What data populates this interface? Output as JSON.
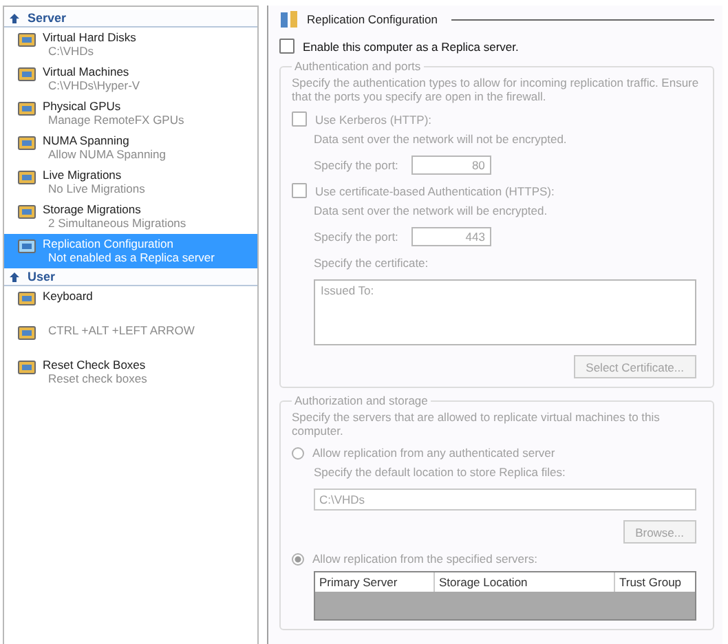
{
  "sidebar": {
    "groups": [
      {
        "title": "Server",
        "items": [
          {
            "title": "Virtual Hard Disks",
            "subtitle": "C:\\VHDs",
            "selected": false
          },
          {
            "title": "Virtual Machines",
            "subtitle": "C:\\VHDs\\Hyper-V",
            "selected": false
          },
          {
            "title": "Physical GPUs",
            "subtitle": "Manage RemoteFX GPUs",
            "selected": false
          },
          {
            "title": "NUMA Spanning",
            "subtitle": "Allow NUMA Spanning",
            "selected": false
          },
          {
            "title": "Live Migrations",
            "subtitle": "No Live Migrations",
            "selected": false
          },
          {
            "title": "Storage Migrations",
            "subtitle": "2 Simultaneous Migrations",
            "selected": false
          },
          {
            "title": "Replication Configuration",
            "subtitle": "Not enabled as a Replica server",
            "selected": true
          }
        ]
      },
      {
        "title": "User",
        "items": [
          {
            "title": "Keyboard",
            "selected": false
          },
          {
            "subtitle": "CTRL +ALT +LEFT ARROW",
            "selected": false
          },
          {
            "title": "Reset Check Boxes",
            "subtitle": "Reset check boxes",
            "selected": false
          }
        ]
      }
    ]
  },
  "panel": {
    "title": "Replication Configuration",
    "enable": {
      "label": "Enable this computer as a Replica server.",
      "checked": false
    },
    "auth": {
      "title": "Authentication and ports",
      "disabled": true,
      "description": "Specify the authentication types to allow for incoming replication traffic. Ensure that the ports you specify are open in the firewall.",
      "kerberos": {
        "label": "Use Kerberos (HTTP):",
        "checked": false,
        "note": "Data sent over the network will not be encrypted.",
        "port_label": "Specify the port:",
        "port": "80"
      },
      "certificate": {
        "label": "Use certificate-based Authentication (HTTPS):",
        "checked": false,
        "note": "Data sent over the network will be encrypted.",
        "port_label": "Specify the port:",
        "port": "443",
        "cert_label": "Specify the certificate:",
        "cert_lines": [
          "Issued To:"
        ],
        "button": "Select Certificate..."
      }
    },
    "authz": {
      "title": "Authorization and storage",
      "disabled": true,
      "description": "Specify the servers that are allowed to replicate virtual machines to this computer.",
      "options": [
        {
          "label": "Allow replication from any authenticated server",
          "selected": false
        },
        {
          "label": "Allow replication from the specified servers:",
          "selected": true
        }
      ],
      "location_label": "Specify the default location to store Replica files:",
      "location": "C:\\VHDs",
      "browse": "Browse...",
      "table": {
        "columns": [
          "Primary Server",
          "Storage Location",
          "Trust Group"
        ]
      }
    }
  }
}
